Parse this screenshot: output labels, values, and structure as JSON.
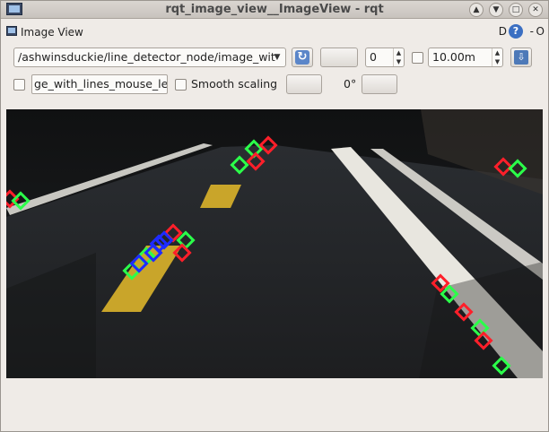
{
  "window": {
    "title": "rqt_image_view__ImageView - rqt"
  },
  "dock": {
    "title": "Image View",
    "help_letter": "D",
    "help_icon": "?",
    "minimize": "-",
    "close": "O"
  },
  "toolbar": {
    "topic": "/ashwinsduckie/line_detector_node/image_wit",
    "refresh_icon": "refresh-icon",
    "spin_value": "0",
    "max_range": "10.00m",
    "save_icon": "save-icon",
    "mouse_topic": "ge_with_lines_mouse_left",
    "smooth_scaling_label": "Smooth scaling",
    "rotation": "0°"
  },
  "image": {
    "markers_red": "#ff1f2a",
    "markers_green": "#2bff4a",
    "markers_blue": "#1e2bff",
    "lane_yellow": "#c9a52a",
    "lane_white": "#e8e6df"
  }
}
